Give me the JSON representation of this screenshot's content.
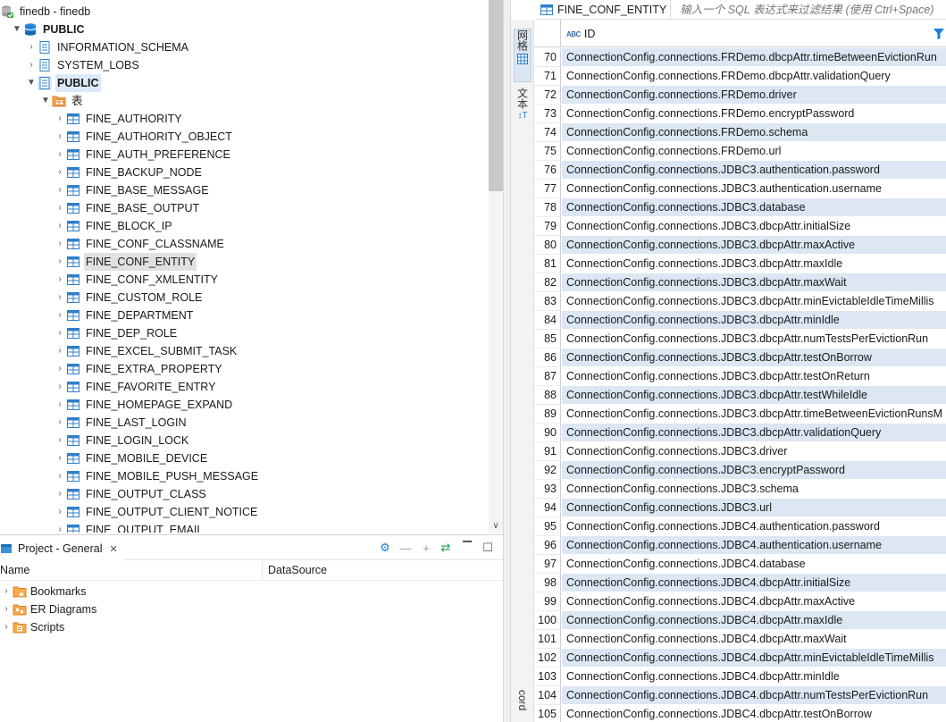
{
  "navigator": {
    "connection": "finedb - finedb",
    "database": "PUBLIC",
    "schemas": [
      "INFORMATION_SCHEMA",
      "SYSTEM_LOBS"
    ],
    "active_schema": "PUBLIC",
    "tables_folder": "表",
    "tables": [
      "FINE_AUTHORITY",
      "FINE_AUTHORITY_OBJECT",
      "FINE_AUTH_PREFERENCE",
      "FINE_BACKUP_NODE",
      "FINE_BASE_MESSAGE",
      "FINE_BASE_OUTPUT",
      "FINE_BLOCK_IP",
      "FINE_CONF_CLASSNAME",
      "FINE_CONF_ENTITY",
      "FINE_CONF_XMLENTITY",
      "FINE_CUSTOM_ROLE",
      "FINE_DEPARTMENT",
      "FINE_DEP_ROLE",
      "FINE_EXCEL_SUBMIT_TASK",
      "FINE_EXTRA_PROPERTY",
      "FINE_FAVORITE_ENTRY",
      "FINE_HOMEPAGE_EXPAND",
      "FINE_LAST_LOGIN",
      "FINE_LOGIN_LOCK",
      "FINE_MOBILE_DEVICE",
      "FINE_MOBILE_PUSH_MESSAGE",
      "FINE_OUTPUT_CLASS",
      "FINE_OUTPUT_CLIENT_NOTICE",
      "FINE_OUTPUT_EMAIL"
    ],
    "selected_table": "FINE_CONF_ENTITY"
  },
  "project": {
    "tab_label": "Project - General",
    "columns": [
      "Name",
      "DataSource"
    ],
    "items": [
      {
        "label": "Bookmarks",
        "icon": "bookmarks-folder-icon"
      },
      {
        "label": "ER Diagrams",
        "icon": "er-diagrams-folder-icon"
      },
      {
        "label": "Scripts",
        "icon": "scripts-folder-icon"
      }
    ]
  },
  "editor": {
    "table_name": "FINE_CONF_ENTITY",
    "filter_placeholder": "输入一个 SQL 表达式来过滤结果 (使用 Ctrl+Space)",
    "side_tabs": {
      "grid": "网格",
      "text": "文本",
      "record": "cord"
    },
    "column_header": "ID",
    "rows": [
      {
        "n": "70",
        "id": "ConnectionConfig.connections.FRDemo.dbcpAttr.timeBetweenEvictionRun"
      },
      {
        "n": "71",
        "id": "ConnectionConfig.connections.FRDemo.dbcpAttr.validationQuery"
      },
      {
        "n": "72",
        "id": "ConnectionConfig.connections.FRDemo.driver"
      },
      {
        "n": "73",
        "id": "ConnectionConfig.connections.FRDemo.encryptPassword"
      },
      {
        "n": "74",
        "id": "ConnectionConfig.connections.FRDemo.schema"
      },
      {
        "n": "75",
        "id": "ConnectionConfig.connections.FRDemo.url"
      },
      {
        "n": "76",
        "id": "ConnectionConfig.connections.JDBC3.authentication.password"
      },
      {
        "n": "77",
        "id": "ConnectionConfig.connections.JDBC3.authentication.username"
      },
      {
        "n": "78",
        "id": "ConnectionConfig.connections.JDBC3.database"
      },
      {
        "n": "79",
        "id": "ConnectionConfig.connections.JDBC3.dbcpAttr.initialSize"
      },
      {
        "n": "80",
        "id": "ConnectionConfig.connections.JDBC3.dbcpAttr.maxActive"
      },
      {
        "n": "81",
        "id": "ConnectionConfig.connections.JDBC3.dbcpAttr.maxIdle"
      },
      {
        "n": "82",
        "id": "ConnectionConfig.connections.JDBC3.dbcpAttr.maxWait"
      },
      {
        "n": "83",
        "id": "ConnectionConfig.connections.JDBC3.dbcpAttr.minEvictableIdleTimeMillis"
      },
      {
        "n": "84",
        "id": "ConnectionConfig.connections.JDBC3.dbcpAttr.minIdle"
      },
      {
        "n": "85",
        "id": "ConnectionConfig.connections.JDBC3.dbcpAttr.numTestsPerEvictionRun"
      },
      {
        "n": "86",
        "id": "ConnectionConfig.connections.JDBC3.dbcpAttr.testOnBorrow"
      },
      {
        "n": "87",
        "id": "ConnectionConfig.connections.JDBC3.dbcpAttr.testOnReturn"
      },
      {
        "n": "88",
        "id": "ConnectionConfig.connections.JDBC3.dbcpAttr.testWhileIdle"
      },
      {
        "n": "89",
        "id": "ConnectionConfig.connections.JDBC3.dbcpAttr.timeBetweenEvictionRunsM"
      },
      {
        "n": "90",
        "id": "ConnectionConfig.connections.JDBC3.dbcpAttr.validationQuery"
      },
      {
        "n": "91",
        "id": "ConnectionConfig.connections.JDBC3.driver"
      },
      {
        "n": "92",
        "id": "ConnectionConfig.connections.JDBC3.encryptPassword"
      },
      {
        "n": "93",
        "id": "ConnectionConfig.connections.JDBC3.schema"
      },
      {
        "n": "94",
        "id": "ConnectionConfig.connections.JDBC3.url"
      },
      {
        "n": "95",
        "id": "ConnectionConfig.connections.JDBC4.authentication.password"
      },
      {
        "n": "96",
        "id": "ConnectionConfig.connections.JDBC4.authentication.username"
      },
      {
        "n": "97",
        "id": "ConnectionConfig.connections.JDBC4.database"
      },
      {
        "n": "98",
        "id": "ConnectionConfig.connections.JDBC4.dbcpAttr.initialSize"
      },
      {
        "n": "99",
        "id": "ConnectionConfig.connections.JDBC4.dbcpAttr.maxActive"
      },
      {
        "n": "100",
        "id": "ConnectionConfig.connections.JDBC4.dbcpAttr.maxIdle"
      },
      {
        "n": "101",
        "id": "ConnectionConfig.connections.JDBC4.dbcpAttr.maxWait"
      },
      {
        "n": "102",
        "id": "ConnectionConfig.connections.JDBC4.dbcpAttr.minEvictableIdleTimeMillis"
      },
      {
        "n": "103",
        "id": "ConnectionConfig.connections.JDBC4.dbcpAttr.minIdle"
      },
      {
        "n": "104",
        "id": "ConnectionConfig.connections.JDBC4.dbcpAttr.numTestsPerEvictionRun"
      },
      {
        "n": "105",
        "id": "ConnectionConfig.connections.JDBC4.dbcpAttr.testOnBorrow"
      }
    ]
  },
  "colors": {
    "accent": "#1e7fd4",
    "row_stripe": "#dde6f3",
    "selection": "#e1e1e1",
    "table_icon": "#2f7fc9",
    "folder_icon": "#e0832b"
  }
}
